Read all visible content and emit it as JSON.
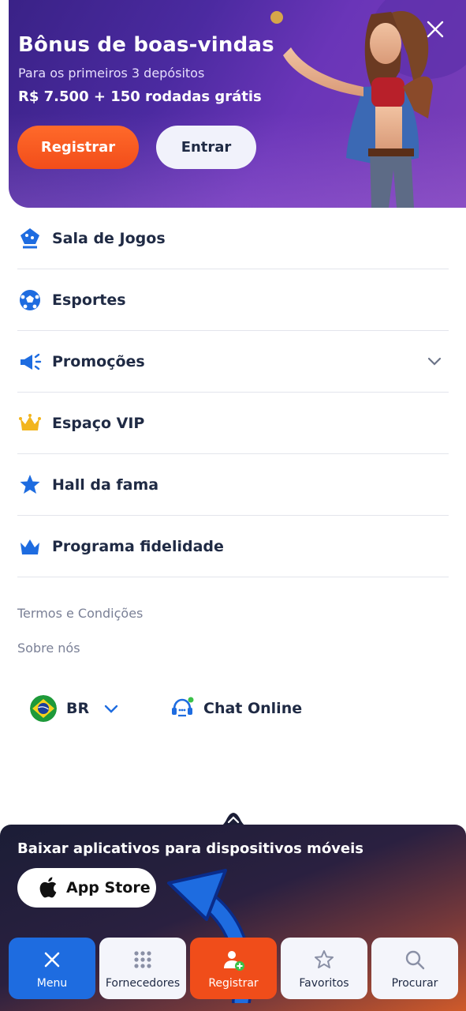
{
  "hero": {
    "title": "Bônus de boas-vindas",
    "subtitle": "Para os primeiros 3 depósitos",
    "offer": "R$ 7.500 + 150 rodadas grátis",
    "register_label": "Registrar",
    "enter_label": "Entrar",
    "close_icon": "close-icon"
  },
  "menu": {
    "items": [
      {
        "label": "Sala de Jogos",
        "icon": "game-room-icon"
      },
      {
        "label": "Esportes",
        "icon": "soccer-ball-icon"
      },
      {
        "label": "Promoções",
        "icon": "megaphone-icon",
        "expandable": true
      },
      {
        "label": "Espaço VIP",
        "icon": "crown-gold-icon"
      },
      {
        "label": "Hall da fama",
        "icon": "star-badge-icon"
      },
      {
        "label": "Programa fidelidade",
        "icon": "crown-blue-icon"
      }
    ]
  },
  "links": {
    "terms": "Termos e Condições",
    "about": "Sobre nós"
  },
  "footer": {
    "language": "BR",
    "chat": "Chat Online"
  },
  "app_panel": {
    "title": "Baixar aplicativos para dispositivos móveis",
    "appstore_label": "App Store"
  },
  "nav": {
    "items": [
      {
        "label": "Menu",
        "icon": "close-icon",
        "state": "active"
      },
      {
        "label": "Fornecedores",
        "icon": "grid-icon"
      },
      {
        "label": "Registrar",
        "icon": "add-user-icon"
      },
      {
        "label": "Favoritos",
        "icon": "star-icon"
      },
      {
        "label": "Procurar",
        "icon": "search-icon"
      }
    ]
  },
  "colors": {
    "brand_blue": "#1e6ce0",
    "brand_orange": "#f24d1a",
    "hero_purple": "#4b2aa0",
    "text_dark": "#1f2a44"
  }
}
